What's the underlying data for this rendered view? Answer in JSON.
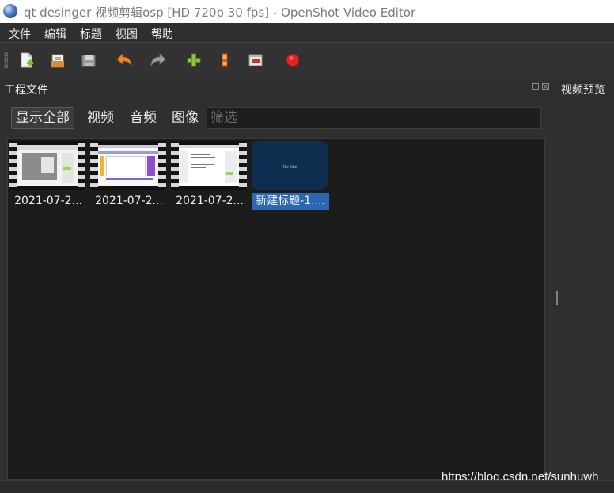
{
  "window": {
    "title": "qt desinger 视频剪辑osp [HD 720p 30 fps] - OpenShot Video Editor"
  },
  "menubar": {
    "items": [
      {
        "label": "文件"
      },
      {
        "label": "编辑"
      },
      {
        "label": "标题"
      },
      {
        "label": "视图"
      },
      {
        "label": "帮助"
      }
    ]
  },
  "toolbar": {
    "buttons": [
      {
        "icon": "new-project-icon"
      },
      {
        "icon": "open-project-icon"
      },
      {
        "icon": "save-project-icon"
      },
      {
        "icon": "undo-icon"
      },
      {
        "icon": "redo-icon"
      },
      {
        "icon": "import-files-icon"
      },
      {
        "icon": "profile-icon"
      },
      {
        "icon": "fullscreen-icon"
      },
      {
        "icon": "export-video-icon"
      }
    ]
  },
  "project_files": {
    "title": "工程文件",
    "filters": [
      {
        "label": "显示全部",
        "active": true
      },
      {
        "label": "视频",
        "active": false
      },
      {
        "label": "音频",
        "active": false
      },
      {
        "label": "图像",
        "active": false
      }
    ],
    "filter_placeholder": "筛选",
    "files": [
      {
        "label": "2021-07-2...",
        "type": "video",
        "selected": false
      },
      {
        "label": "2021-07-2...",
        "type": "video",
        "selected": false
      },
      {
        "label": "2021-07-2...",
        "type": "video",
        "selected": false
      },
      {
        "label": "新建标题-1....",
        "type": "title",
        "selected": true,
        "thumb_text": "The Title"
      }
    ]
  },
  "video_preview": {
    "title": "视频预览"
  },
  "watermark": "https://blog.csdn.net/sunhuwh",
  "colors": {
    "background": "#2f2f2f",
    "selection": "#2b68b4",
    "title_thumb": "#0f2d4e",
    "record_red": "#e02424",
    "add_green": "#8cc63f"
  }
}
